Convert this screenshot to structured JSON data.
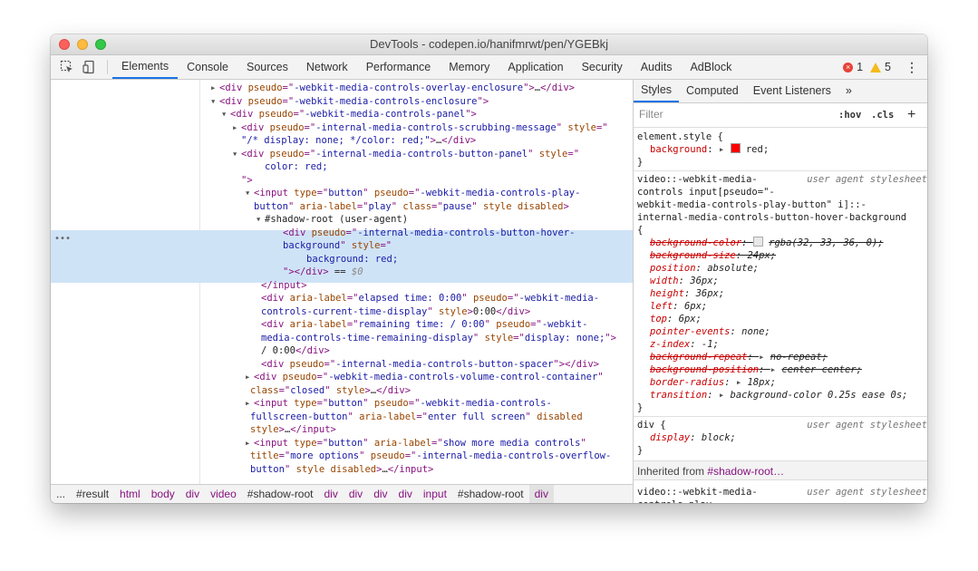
{
  "window": {
    "title": "DevTools - codepen.io/hanifmrwt/pen/YGEBkj"
  },
  "toolbar": {
    "tabs": [
      "Elements",
      "Console",
      "Sources",
      "Network",
      "Performance",
      "Memory",
      "Application",
      "Security",
      "Audits",
      "AdBlock"
    ],
    "errors": "1",
    "warnings": "5"
  },
  "elements_lines": [
    {
      "parts": [
        [
          "tag",
          "<div "
        ],
        [
          "an",
          "pseudo"
        ],
        [
          "tag",
          "=\""
        ],
        [
          "av",
          "-webkit-media-controls-overlay-enclosure"
        ],
        [
          "tag",
          "\">"
        ],
        [
          "cm",
          "…"
        ],
        [
          "tag",
          "</div>"
        ]
      ]
    },
    {
      "parts": [
        [
          "tag",
          "<div "
        ],
        [
          "an",
          "pseudo"
        ],
        [
          "tag",
          "=\""
        ],
        [
          "av",
          "-webkit-media-controls-enclosure"
        ],
        [
          "tag",
          "\">"
        ]
      ]
    },
    {
      "parts": [
        [
          "tag",
          "<div "
        ],
        [
          "an",
          "pseudo"
        ],
        [
          "tag",
          "=\""
        ],
        [
          "av",
          "-webkit-media-controls-panel"
        ],
        [
          "tag",
          "\">"
        ]
      ]
    },
    {
      "parts": [
        [
          "tag",
          "<div "
        ],
        [
          "an",
          "pseudo"
        ],
        [
          "tag",
          "=\""
        ],
        [
          "av",
          "-internal-media-controls-scrubbing-message"
        ],
        [
          "tag",
          "\" "
        ],
        [
          "an",
          "style"
        ],
        [
          "tag",
          "=\""
        ]
      ]
    },
    {
      "parts": [
        [
          "av",
          "\"/* display: none; */color: red;\""
        ],
        [
          "tag",
          ">"
        ],
        [
          "cm",
          "…"
        ],
        [
          "tag",
          "</div>"
        ]
      ]
    },
    {
      "parts": [
        [
          "tag",
          "<div "
        ],
        [
          "an",
          "pseudo"
        ],
        [
          "tag",
          "=\""
        ],
        [
          "av",
          "-internal-media-controls-button-panel"
        ],
        [
          "tag",
          "\" "
        ],
        [
          "an",
          "style"
        ],
        [
          "tag",
          "=\""
        ]
      ]
    },
    {
      "parts": [
        [
          "av",
          "color: red;"
        ]
      ]
    },
    {
      "parts": [
        [
          "tag",
          "\">"
        ]
      ]
    },
    {
      "parts": [
        [
          "tag",
          "<input "
        ],
        [
          "an",
          "type"
        ],
        [
          "tag",
          "=\""
        ],
        [
          "av",
          "button"
        ],
        [
          "tag",
          "\" "
        ],
        [
          "an",
          "pseudo"
        ],
        [
          "tag",
          "=\""
        ],
        [
          "av",
          "-webkit-media-controls-play-"
        ]
      ]
    },
    {
      "parts": [
        [
          "av",
          "button"
        ],
        [
          "tag",
          "\" "
        ],
        [
          "an",
          "aria-label"
        ],
        [
          "tag",
          "=\""
        ],
        [
          "av",
          "play"
        ],
        [
          "tag",
          "\" "
        ],
        [
          "an",
          "class"
        ],
        [
          "tag",
          "=\""
        ],
        [
          "av",
          "pause"
        ],
        [
          "tag",
          "\" "
        ],
        [
          "an",
          "style disabled"
        ],
        [
          "tag",
          ">"
        ]
      ]
    },
    {
      "parts": [
        [
          "cm",
          "#shadow-root (user-agent)"
        ]
      ]
    },
    {
      "parts": [
        [
          "tag",
          "<div "
        ],
        [
          "an",
          "pseudo"
        ],
        [
          "tag",
          "=\""
        ],
        [
          "av",
          "-internal-media-controls-button-hover-"
        ]
      ]
    },
    {
      "parts": [
        [
          "av",
          "background"
        ],
        [
          "tag",
          "\" "
        ],
        [
          "an",
          "style"
        ],
        [
          "tag",
          "=\""
        ]
      ]
    },
    {
      "parts": [
        [
          "av",
          "background: red;"
        ]
      ]
    },
    {
      "parts": [
        [
          "tag",
          "\"></div>"
        ],
        [
          "cm",
          " == "
        ],
        [
          "gr",
          "$0"
        ]
      ]
    },
    {
      "parts": [
        [
          "tag",
          "</input>"
        ]
      ]
    },
    {
      "parts": [
        [
          "tag",
          "<div "
        ],
        [
          "an",
          "aria-label"
        ],
        [
          "tag",
          "=\""
        ],
        [
          "av",
          "elapsed time: 0:00"
        ],
        [
          "tag",
          "\" "
        ],
        [
          "an",
          "pseudo"
        ],
        [
          "tag",
          "=\""
        ],
        [
          "av",
          "-webkit-media-"
        ]
      ]
    },
    {
      "parts": [
        [
          "av",
          "controls-current-time-display"
        ],
        [
          "tag",
          "\" "
        ],
        [
          "an",
          "style"
        ],
        [
          "tag",
          ">"
        ],
        [
          "cm",
          "0:00"
        ],
        [
          "tag",
          "</div>"
        ]
      ]
    },
    {
      "parts": [
        [
          "tag",
          "<div "
        ],
        [
          "an",
          "aria-label"
        ],
        [
          "tag",
          "=\""
        ],
        [
          "av",
          "remaining time: / 0:00"
        ],
        [
          "tag",
          "\" "
        ],
        [
          "an",
          "pseudo"
        ],
        [
          "tag",
          "=\""
        ],
        [
          "av",
          "-webkit-"
        ]
      ]
    },
    {
      "parts": [
        [
          "av",
          "media-controls-time-remaining-display"
        ],
        [
          "tag",
          "\" "
        ],
        [
          "an",
          "style"
        ],
        [
          "tag",
          "=\""
        ],
        [
          "av",
          "display: none;"
        ],
        [
          "tag",
          "\">"
        ]
      ]
    },
    {
      "parts": [
        [
          "cm",
          "/ 0:00"
        ],
        [
          "tag",
          "</div>"
        ]
      ]
    },
    {
      "parts": [
        [
          "tag",
          "<div "
        ],
        [
          "an",
          "pseudo"
        ],
        [
          "tag",
          "=\""
        ],
        [
          "av",
          "-internal-media-controls-button-spacer"
        ],
        [
          "tag",
          "\"></div>"
        ]
      ]
    },
    {
      "parts": [
        [
          "tag",
          "<div "
        ],
        [
          "an",
          "pseudo"
        ],
        [
          "tag",
          "=\""
        ],
        [
          "av",
          "-webkit-media-controls-volume-control-container"
        ],
        [
          "tag",
          "\""
        ]
      ]
    },
    {
      "parts": [
        [
          "an",
          "class"
        ],
        [
          "tag",
          "=\""
        ],
        [
          "av",
          "closed"
        ],
        [
          "tag",
          "\" "
        ],
        [
          "an",
          "style"
        ],
        [
          "tag",
          ">"
        ],
        [
          "cm",
          "…"
        ],
        [
          "tag",
          "</div>"
        ]
      ]
    },
    {
      "parts": [
        [
          "tag",
          "<input "
        ],
        [
          "an",
          "type"
        ],
        [
          "tag",
          "=\""
        ],
        [
          "av",
          "button"
        ],
        [
          "tag",
          "\" "
        ],
        [
          "an",
          "pseudo"
        ],
        [
          "tag",
          "=\""
        ],
        [
          "av",
          "-webkit-media-controls-"
        ]
      ]
    },
    {
      "parts": [
        [
          "av",
          "fullscreen-button"
        ],
        [
          "tag",
          "\" "
        ],
        [
          "an",
          "aria-label"
        ],
        [
          "tag",
          "=\""
        ],
        [
          "av",
          "enter full screen"
        ],
        [
          "tag",
          "\" "
        ],
        [
          "an",
          "disabled"
        ]
      ]
    },
    {
      "parts": [
        [
          "an",
          "style"
        ],
        [
          "tag",
          ">"
        ],
        [
          "cm",
          "…"
        ],
        [
          "tag",
          "</input>"
        ]
      ]
    },
    {
      "parts": [
        [
          "tag",
          "<input "
        ],
        [
          "an",
          "type"
        ],
        [
          "tag",
          "=\""
        ],
        [
          "av",
          "button"
        ],
        [
          "tag",
          "\" "
        ],
        [
          "an",
          "aria-label"
        ],
        [
          "tag",
          "=\""
        ],
        [
          "av",
          "show more media controls"
        ],
        [
          "tag",
          "\""
        ]
      ]
    },
    {
      "parts": [
        [
          "an",
          "title"
        ],
        [
          "tag",
          "=\""
        ],
        [
          "av",
          "more options"
        ],
        [
          "tag",
          "\" "
        ],
        [
          "an",
          "pseudo"
        ],
        [
          "tag",
          "=\""
        ],
        [
          "av",
          "-internal-media-controls-overflow-"
        ]
      ]
    },
    {
      "parts": [
        [
          "av",
          "button"
        ],
        [
          "tag",
          "\" "
        ],
        [
          "an",
          "style disabled"
        ],
        [
          "tag",
          ">"
        ],
        [
          "cm",
          "…"
        ],
        [
          "tag",
          "</input>"
        ]
      ]
    }
  ],
  "breadcrumbs": [
    "#result",
    "html",
    "body",
    "div",
    "video",
    "#shadow-root",
    "div",
    "div",
    "div",
    "div",
    "input",
    "#shadow-root",
    "div"
  ],
  "breadcrumbs_overflow": "...",
  "styles": {
    "tabs": [
      "Styles",
      "Computed",
      "Event Listeners"
    ],
    "more_tabs": "»",
    "filter_placeholder": "Filter",
    "hov": ":hov",
    "cls": ".cls",
    "add": "+",
    "element_style": {
      "selector": "element.style {",
      "prop": "background",
      "value": "red;",
      "close": "}"
    },
    "rule1": {
      "selector": [
        "video::-webkit-media-",
        "controls input[pseudo=\"-",
        "webkit-media-controls-play-button\" i]::-",
        "internal-media-controls-button-hover-background",
        "{"
      ],
      "origin": "user agent stylesheet",
      "props": [
        {
          "name": "background-color",
          "value": "rgba(32, 33, 36, 0);",
          "struck": true,
          "swatch": "rgba"
        },
        {
          "name": "background-size",
          "value": "24px;",
          "struck": true
        },
        {
          "name": "position",
          "value": "absolute;"
        },
        {
          "name": "width",
          "value": "36px;"
        },
        {
          "name": "height",
          "value": "36px;"
        },
        {
          "name": "left",
          "value": "6px;"
        },
        {
          "name": "top",
          "value": "6px;"
        },
        {
          "name": "pointer-events",
          "value": "none;"
        },
        {
          "name": "z-index",
          "value": "-1;"
        },
        {
          "name": "background-repeat",
          "value": "no-repeat;",
          "struck": true,
          "arrow": true
        },
        {
          "name": "background-position",
          "value": "center center;",
          "struck": true,
          "arrow": true
        },
        {
          "name": "border-radius",
          "value": "18px;",
          "arrow": true
        },
        {
          "name": "transition",
          "value": "background-color 0.25s ease 0s;",
          "arrow": true
        }
      ],
      "close": "}"
    },
    "rule2": {
      "selector": "div {",
      "origin": "user agent stylesheet",
      "prop": "display",
      "value": "block;",
      "close": "}"
    },
    "inherited_label": "Inherited from",
    "inherited_link": "#shadow-root…",
    "rule3": {
      "selector": [
        "video::-webkit-media-",
        "controls-play-"
      ],
      "origin": "user agent stylesheet"
    }
  },
  "colors": {
    "tag": "#881280",
    "attr_name": "#994500",
    "attr_value": "#1a1aa6",
    "accent": "#1a73e8",
    "selected_bg": "#cfe3f7"
  }
}
